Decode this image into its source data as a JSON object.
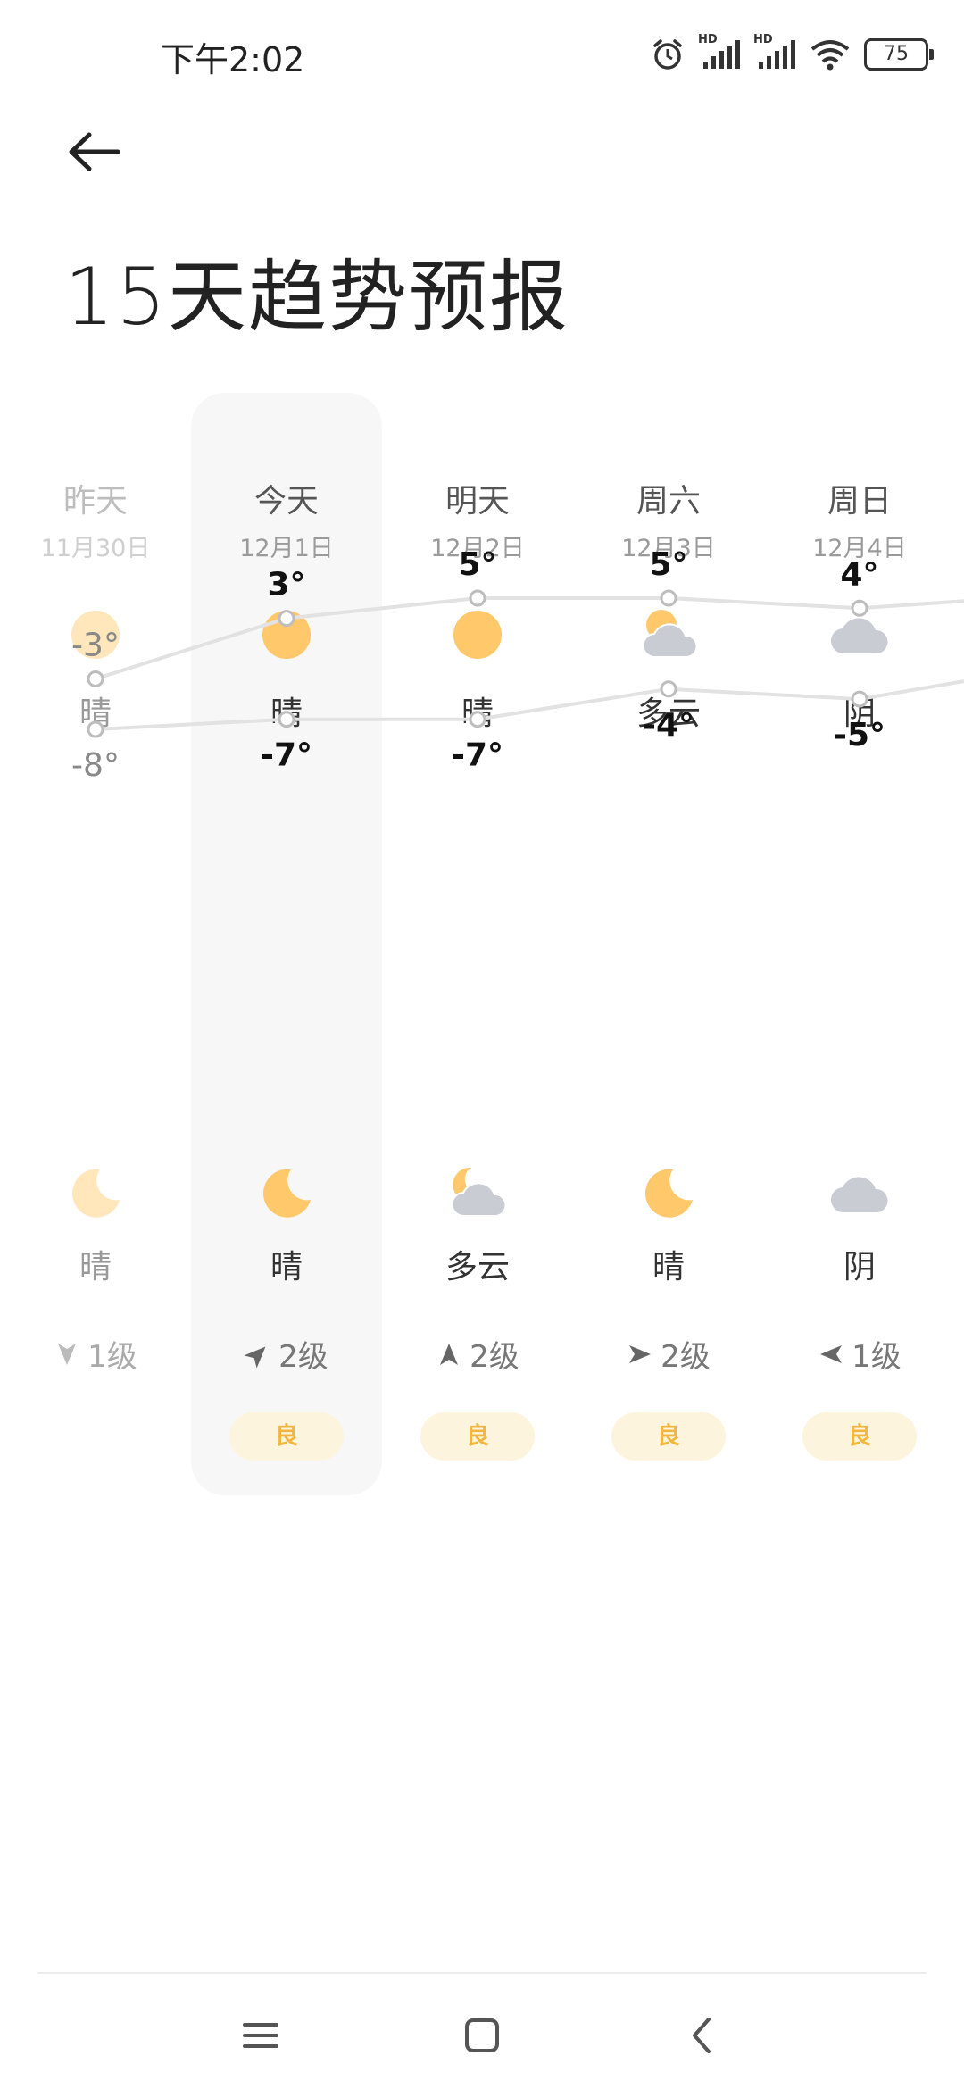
{
  "status_bar": {
    "time": "下午2:02",
    "battery": "75",
    "network_1": "HD",
    "network_2": "HD"
  },
  "header": {
    "title": "15天趋势预报"
  },
  "days": [
    {
      "name": "昨天",
      "date": "11月30日",
      "day_icon": "sun-icon",
      "day_cond": "晴",
      "high": "-3°",
      "low": "-8°",
      "night_icon": "moon-icon",
      "night_cond": "晴",
      "wind": "1级",
      "wind_dir": "south",
      "aqi": "",
      "dim": true
    },
    {
      "name": "今天",
      "date": "12月1日",
      "day_icon": "sun-icon",
      "day_cond": "晴",
      "high": "3°",
      "low": "-7°",
      "night_icon": "moon-icon",
      "night_cond": "晴",
      "wind": "2级",
      "wind_dir": "northeast",
      "aqi": "良",
      "dim": false
    },
    {
      "name": "明天",
      "date": "12月2日",
      "day_icon": "sun-icon",
      "day_cond": "晴",
      "high": "5°",
      "low": "-7°",
      "night_icon": "cloudy-night-icon",
      "night_cond": "多云",
      "wind": "2级",
      "wind_dir": "north",
      "aqi": "良",
      "dim": false
    },
    {
      "name": "周六",
      "date": "12月3日",
      "day_icon": "partly-cloudy-icon",
      "day_cond": "多云",
      "high": "5°",
      "low": "-4°",
      "night_icon": "moon-icon",
      "night_cond": "晴",
      "wind": "2级",
      "wind_dir": "east",
      "aqi": "良",
      "dim": false
    },
    {
      "name": "周日",
      "date": "12月4日",
      "day_icon": "cloud-icon",
      "day_cond": "阴",
      "high": "4°",
      "low": "-5°",
      "night_icon": "cloud-icon",
      "night_cond": "阴",
      "wind": "1级",
      "wind_dir": "west",
      "aqi": "良",
      "dim": false
    }
  ],
  "chart_data": {
    "type": "line",
    "categories": [
      "昨天",
      "今天",
      "明天",
      "周六",
      "周日"
    ],
    "series": [
      {
        "values": [
          -3,
          3,
          5,
          5,
          4
        ],
        "color": "#e2e2e2"
      },
      {
        "values": [
          -8,
          -7,
          -7,
          -4,
          -5
        ],
        "color": "#e2e2e2"
      }
    ]
  },
  "colors": {
    "sun": "#ffc86a",
    "cloud": "#c9cdd3",
    "aqi_bg": "#fdf4dd",
    "aqi_text": "#f0b640",
    "today_bg": "#f7f7f7"
  },
  "nav": {
    "menu_icon": "menu-icon",
    "home_icon": "home-icon",
    "back_icon": "back-icon"
  }
}
